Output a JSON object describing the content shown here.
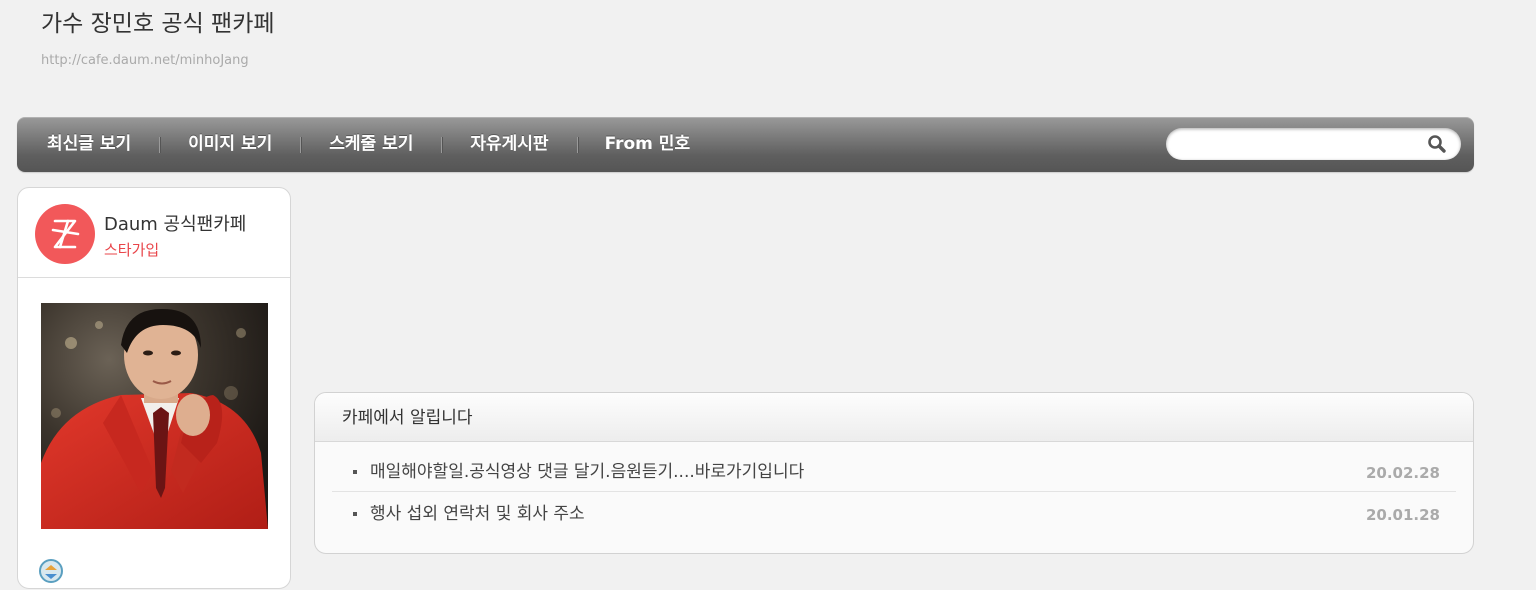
{
  "header": {
    "title": "가수 장민호 공식 팬카페",
    "url": "http://cafe.daum.net/minhoJang"
  },
  "nav": {
    "items": [
      {
        "label": "최신글 보기"
      },
      {
        "label": "이미지 보기"
      },
      {
        "label": "스케줄 보기"
      },
      {
        "label": "자유게시판"
      },
      {
        "label": "From 민호"
      }
    ],
    "search_placeholder": "",
    "search_icon": "magnifier-icon"
  },
  "sidebar": {
    "fancafe_title": "Daum 공식팬카페",
    "fancafe_sub": "스타가입",
    "logo_icon": "daum-star-logo",
    "logo_color": "#f2585a"
  },
  "notice": {
    "title": "카페에서 알립니다",
    "rows": [
      {
        "text": "매일해야할일.공식영상 댓글 달기.음원듣기....바로가기입니다",
        "date": "20.02.28"
      },
      {
        "text": "행사 섭외 연락처 및 회사 주소",
        "date": "20.01.28"
      }
    ]
  }
}
